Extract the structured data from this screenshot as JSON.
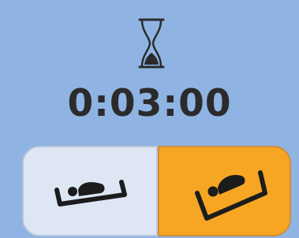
{
  "timer": {
    "value": "0:03:00"
  },
  "icons": {
    "top": "hourglass-icon",
    "left_button": "bed-flat-icon",
    "right_button": "bed-incline-icon"
  },
  "colors": {
    "background": "#8fb4e3",
    "left_button": "#dee6f4",
    "right_button_active": "#f6a623",
    "text": "#2b2b2b"
  }
}
